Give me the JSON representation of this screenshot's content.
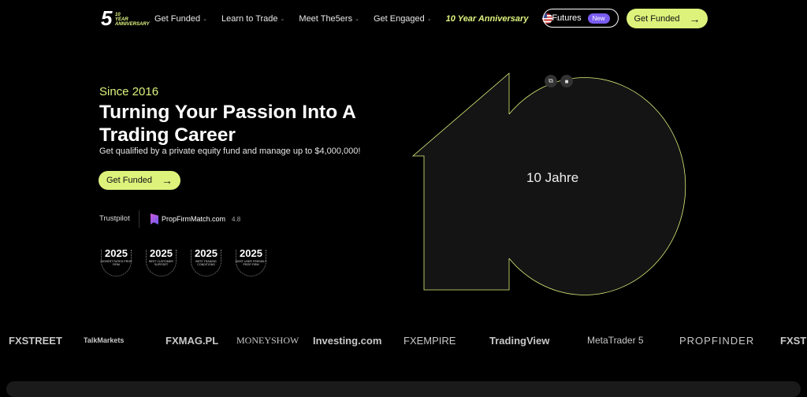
{
  "nav": {
    "logo_number": "5",
    "logo_badge_number": "10",
    "logo_badge_text_1": "YEAR",
    "logo_badge_text_2": "ANNIVERSARY",
    "items": [
      {
        "label": "Get Funded",
        "has_dropdown": true
      },
      {
        "label": "Learn to Trade",
        "has_dropdown": true
      },
      {
        "label": "Meet The5ers",
        "has_dropdown": true
      },
      {
        "label": "Get Engaged",
        "has_dropdown": true
      }
    ],
    "anniversary_link": "10 Year Anniversary",
    "language_flag": "us-flag-icon",
    "futures_label": "Futures",
    "futures_badge": "New",
    "cta_label": "Get Funded"
  },
  "hero": {
    "since": "Since 2016",
    "title_line1": "Turning Your Passion Into A",
    "title_line2": "Trading Career",
    "subtitle": "Get qualified by a private equity fund and manage up to $4,000,000!",
    "cta_label": "Get Funded"
  },
  "reviews": {
    "trustpilot": "Trustpilot",
    "pfm_name": "PropFirmMatch.com",
    "pfm_rating": "4.8"
  },
  "awards": [
    {
      "year": "2025",
      "caption": "HIGHEST RATED PROP FIRM"
    },
    {
      "year": "2025",
      "caption": "BEST CUSTOMER SUPPORT"
    },
    {
      "year": "2025",
      "caption": "BEST TRADING CONDITIONS"
    },
    {
      "year": "2025",
      "caption": "MOST USER FRIENDLY PROP FIRM"
    }
  ],
  "video": {
    "label": "10 Jahre"
  },
  "partners": [
    "FXSTREET",
    "TalkMarkets",
    "FXMAG.PL",
    "MONEYSHOW",
    "Investing.com",
    "FXEMPIRE",
    "TradingView",
    "MetaTrader 5",
    "PROPFINDER",
    "FXSTREET"
  ],
  "colors": {
    "accent": "#dcf27b",
    "badge": "#7a5cf0",
    "background": "#000000"
  }
}
